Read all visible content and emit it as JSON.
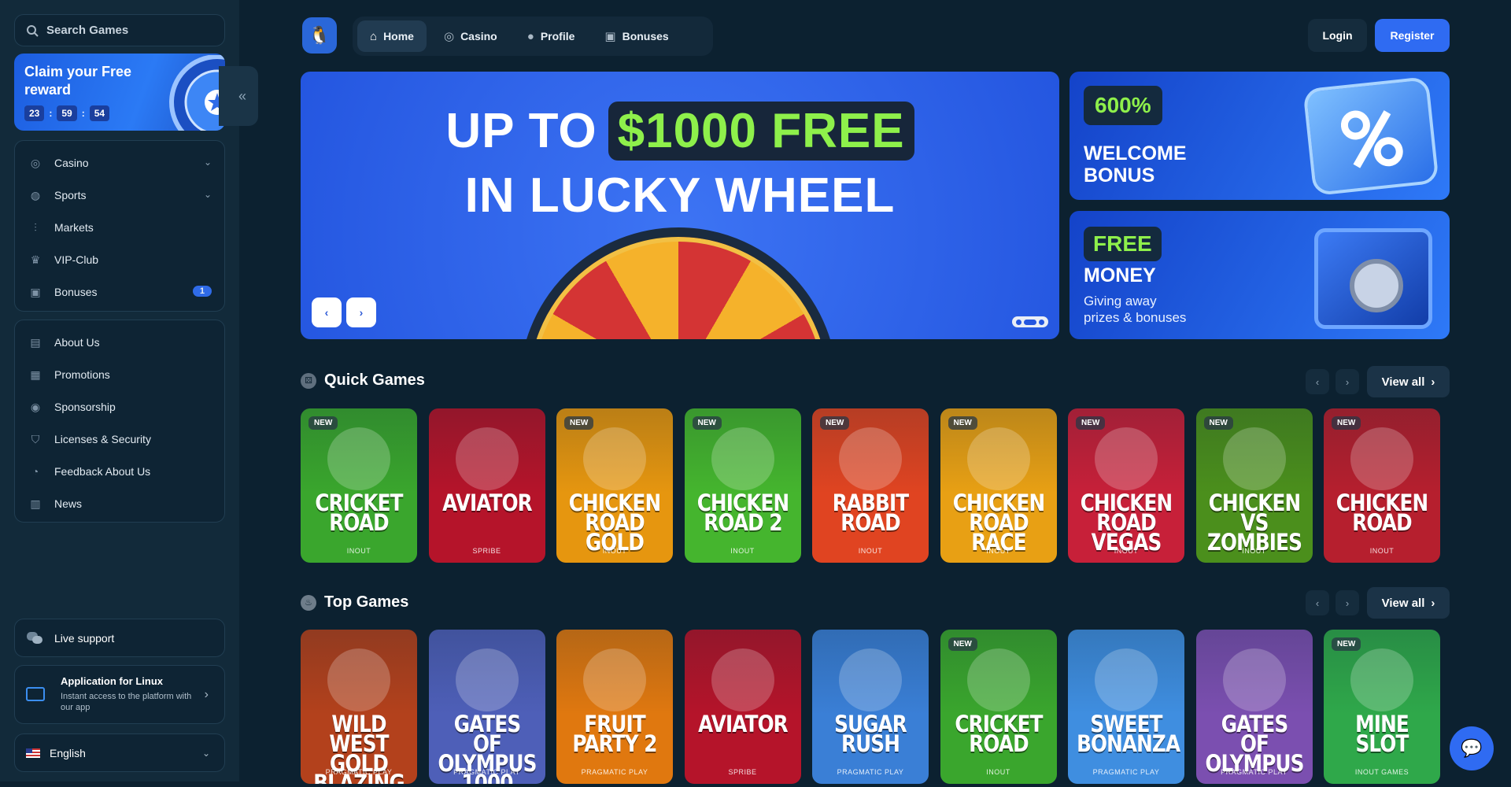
{
  "sidebar": {
    "search_placeholder": "Search Games",
    "reward": {
      "title": "Claim your Free reward",
      "hours": "23",
      "minutes": "59",
      "seconds": "54"
    },
    "nav1": [
      {
        "label": "Casino",
        "icon": "casino-chip-icon",
        "expandable": true
      },
      {
        "label": "Sports",
        "icon": "globe-icon",
        "expandable": true
      },
      {
        "label": "Markets",
        "icon": "candles-icon"
      },
      {
        "label": "VIP-Club",
        "icon": "crown-icon"
      },
      {
        "label": "Bonuses",
        "icon": "gift-icon",
        "badge": "1"
      }
    ],
    "nav2": [
      {
        "label": "About Us",
        "icon": "book-icon"
      },
      {
        "label": "Promotions",
        "icon": "ticket-icon"
      },
      {
        "label": "Sponsorship",
        "icon": "medal-icon"
      },
      {
        "label": "Licenses & Security",
        "icon": "shield-icon"
      },
      {
        "label": "Feedback About Us",
        "icon": "feedback-icon"
      },
      {
        "label": "News",
        "icon": "newspaper-icon"
      }
    ],
    "live_support": "Live support",
    "app": {
      "title": "Application for Linux",
      "subtitle": "Instant access to the platform with our app"
    },
    "language": "English"
  },
  "topnav": {
    "tabs": [
      {
        "label": "Home",
        "icon": "home-icon",
        "active": true
      },
      {
        "label": "Casino",
        "icon": "casino-chip-icon"
      },
      {
        "label": "Profile",
        "icon": "user-icon"
      },
      {
        "label": "Bonuses",
        "icon": "gift-icon"
      }
    ],
    "login": "Login",
    "register": "Register"
  },
  "hero": {
    "line1_prefix": "UP TO",
    "line1_highlight": "$1000 FREE",
    "line2": "IN LUCKY WHEEL",
    "slide_count": 3,
    "active_slide": 2
  },
  "promos": [
    {
      "tag": "600%",
      "title_lines": [
        "WELCOME",
        "BONUS"
      ],
      "subtitle_lines": []
    },
    {
      "tag": "FREE",
      "title_lines": [
        "MONEY"
      ],
      "subtitle_lines": [
        "Giving away",
        "prizes & bonuses"
      ]
    }
  ],
  "sections": {
    "quick": {
      "title": "Quick Games",
      "view_all": "View all",
      "icon": "dice-icon"
    },
    "top": {
      "title": "Top Games",
      "view_all": "View all",
      "icon": "fire-icon"
    }
  },
  "quick_games": [
    {
      "title": "CRICKET ROAD",
      "provider": "INOUT",
      "new": true,
      "bg": "#3aa62d"
    },
    {
      "title": "AVIATOR",
      "provider": "SPRIBE",
      "new": false,
      "bg": "#b5142a"
    },
    {
      "title": "CHICKEN ROAD GOLD",
      "provider": "INOUT",
      "new": true,
      "bg": "#e6960f"
    },
    {
      "title": "CHICKEN ROAD 2",
      "provider": "INOUT",
      "new": true,
      "bg": "#45b52e"
    },
    {
      "title": "RABBIT ROAD",
      "provider": "INOUT",
      "new": true,
      "bg": "#e04421"
    },
    {
      "title": "CHICKEN ROAD RACE",
      "provider": "INOUT",
      "new": true,
      "bg": "#e8a014"
    },
    {
      "title": "CHICKEN ROAD VEGAS",
      "provider": "INOUT",
      "new": true,
      "bg": "#c72039"
    },
    {
      "title": "CHICKEN VS ZOMBIES",
      "provider": "INOUT",
      "new": true,
      "bg": "#4b8f1c"
    },
    {
      "title": "CHICKEN ROAD",
      "provider": "INOUT",
      "new": true,
      "bg": "#b61f2e"
    }
  ],
  "top_games": [
    {
      "title": "WILD WEST GOLD BLAZING BOUNTY",
      "provider": "PRAGMATIC PLAY",
      "new": false,
      "bg": "#b3411c"
    },
    {
      "title": "GATES OF OLYMPUS 1000",
      "provider": "PRAGMATIC PLAY",
      "new": false,
      "bg": "#4e5fb8"
    },
    {
      "title": "FRUIT PARTY 2",
      "provider": "PRAGMATIC PLAY",
      "new": false,
      "bg": "#e0780f"
    },
    {
      "title": "AVIATOR",
      "provider": "SPRIBE",
      "new": false,
      "bg": "#b5142a"
    },
    {
      "title": "SUGAR RUSH",
      "provider": "PRAGMATIC PLAY",
      "new": false,
      "bg": "#3a7fd6"
    },
    {
      "title": "CRICKET ROAD",
      "provider": "INOUT",
      "new": true,
      "bg": "#3aa62d"
    },
    {
      "title": "SWEET BONANZA",
      "provider": "PRAGMATIC PLAY",
      "new": false,
      "bg": "#3f8ee0"
    },
    {
      "title": "GATES OF OLYMPUS",
      "provider": "PRAGMATIC PLAY",
      "new": false,
      "bg": "#7b4fb0"
    },
    {
      "title": "MINE SLOT",
      "provider": "INOUT GAMES",
      "new": true,
      "bg": "#2fa84a"
    }
  ],
  "labels": {
    "new": "NEW"
  }
}
